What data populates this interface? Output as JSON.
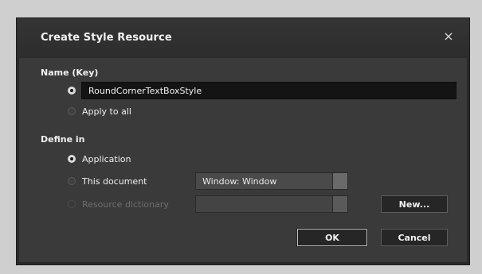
{
  "dialog": {
    "title": "Create Style Resource",
    "close_icon": "×"
  },
  "name_section": {
    "label": "Name (Key)",
    "key_value": "RoundCornerTextBoxStyle",
    "apply_all_label": "Apply to all",
    "selected": "key"
  },
  "define_section": {
    "label": "Define in",
    "options": [
      {
        "label": "Application",
        "selected": true,
        "disabled": false
      },
      {
        "label": "This document",
        "selected": false,
        "disabled": false
      },
      {
        "label": "Resource dictionary",
        "selected": false,
        "disabled": true
      }
    ],
    "document_combo_value": "Window: Window",
    "dictionary_combo_value": ""
  },
  "buttons": {
    "new_label": "New...",
    "ok_label": "OK",
    "cancel_label": "Cancel"
  }
}
